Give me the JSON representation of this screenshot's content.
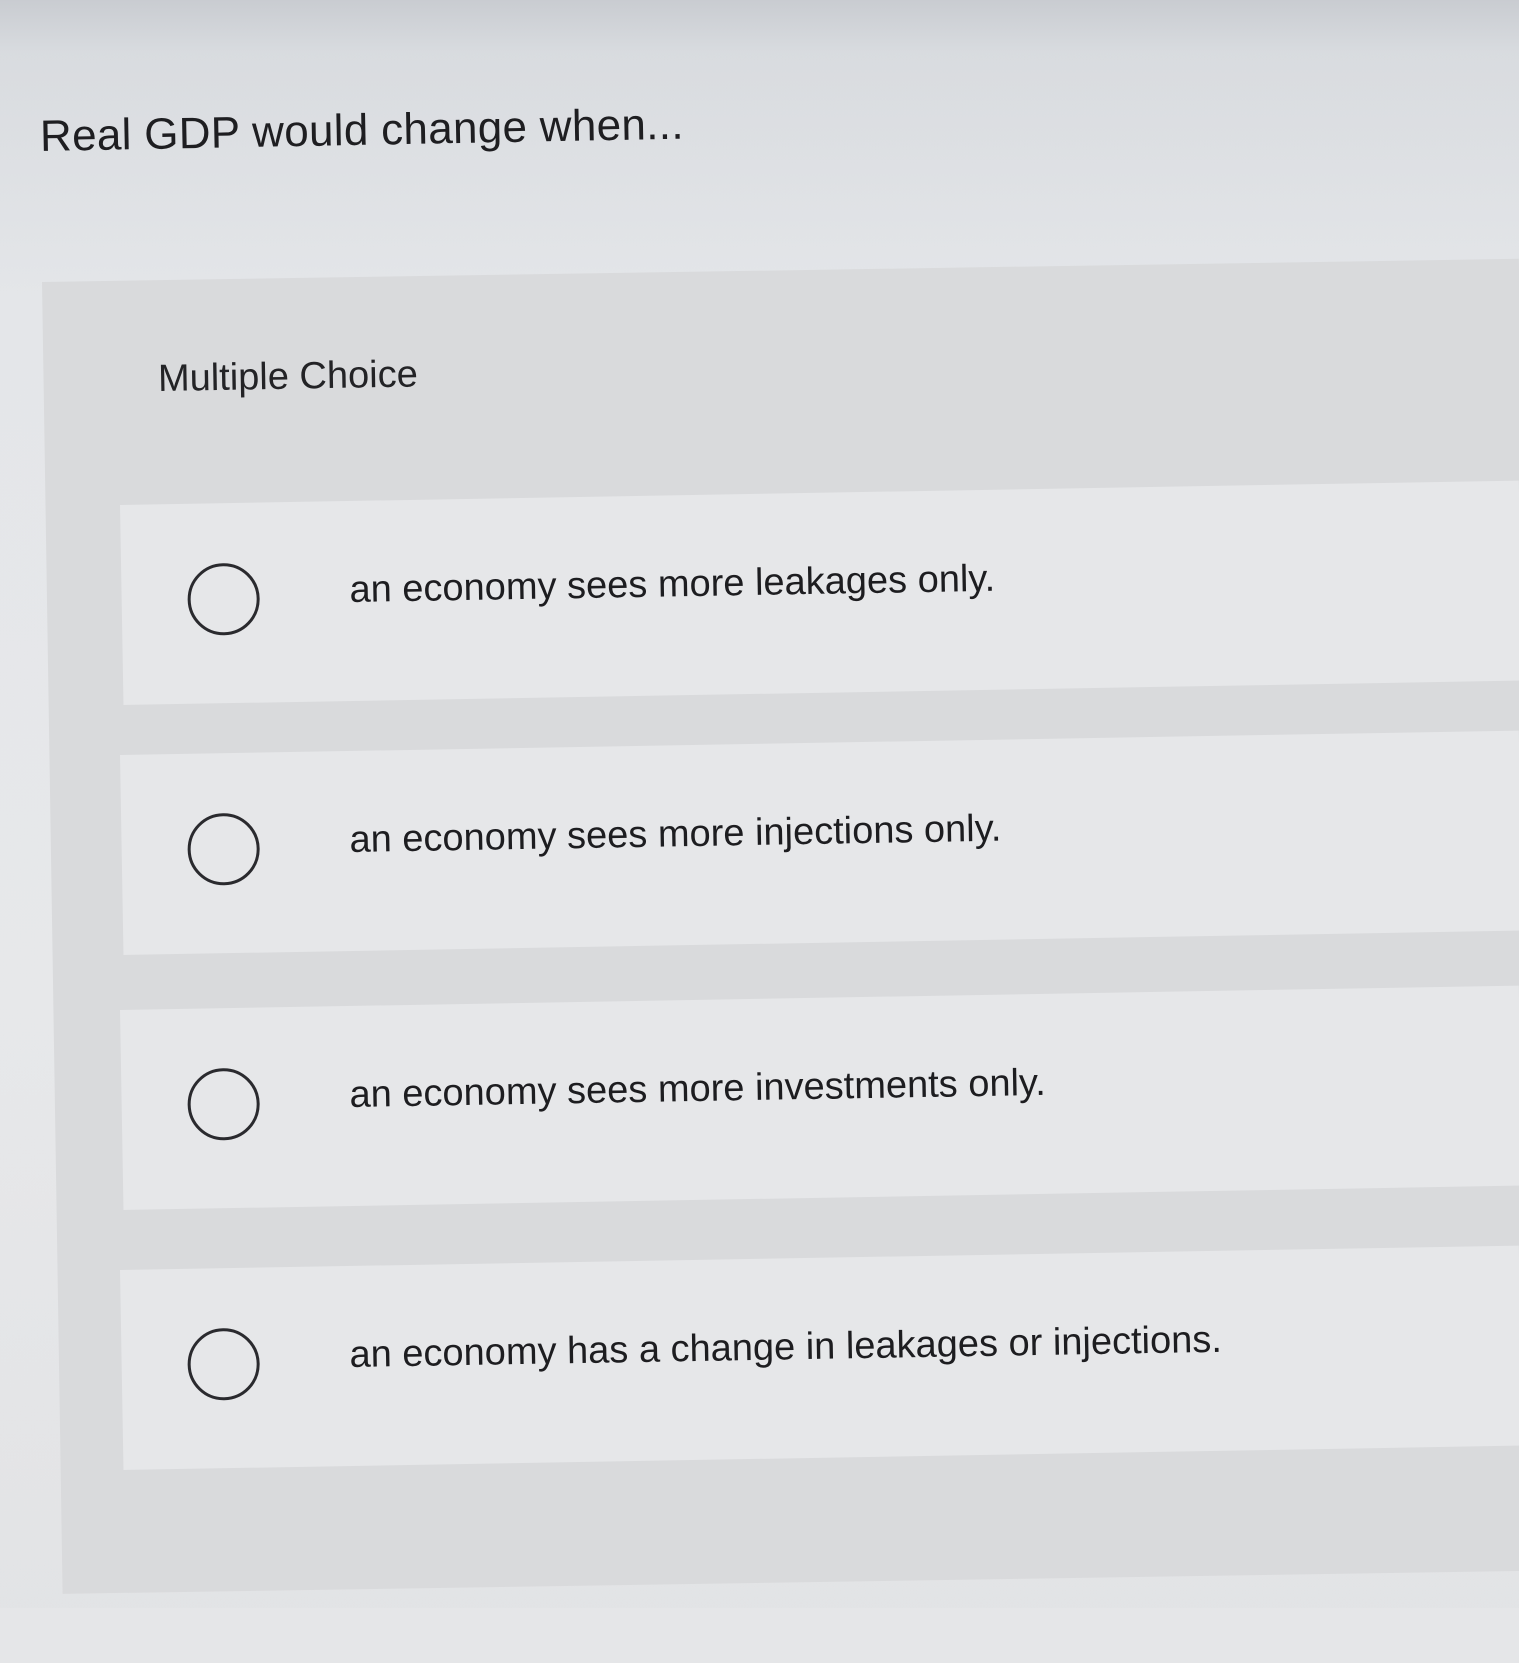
{
  "question": {
    "text": "Real GDP would change when..."
  },
  "answer_block": {
    "type_label": "Multiple Choice",
    "selected_index": null,
    "options": [
      {
        "label": "an economy sees more leakages only."
      },
      {
        "label": "an economy sees more injections only."
      },
      {
        "label": "an economy sees more investments only."
      },
      {
        "label": "an economy has a change in leakages or injections."
      }
    ]
  },
  "colors": {
    "panel_background": "#d9dadc",
    "option_background": "#e6e7e9",
    "text": "#1d1d20",
    "radio_border": "#2a2a2e"
  }
}
